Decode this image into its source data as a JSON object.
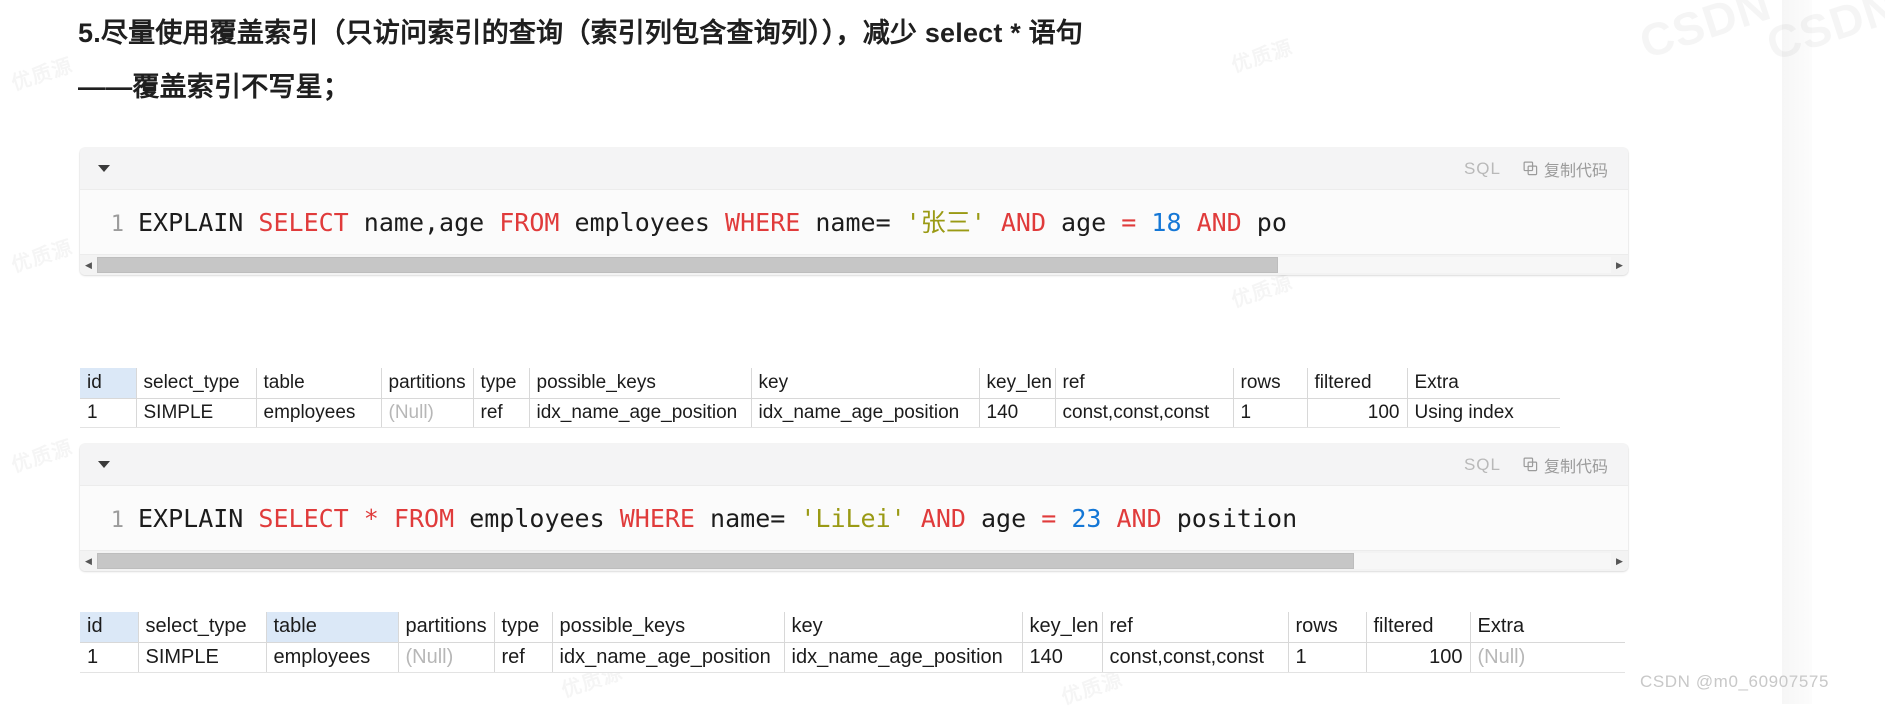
{
  "page": {
    "heading_line1": "5.尽量使用覆盖索引（只访问索引的查询（索引列包含查询列）），减少 select * 语句",
    "heading_line2": "——覆盖索引不写星；",
    "watermark": "CSDN @m0_60907575",
    "bg_watermarks": [
      "CSDN",
      "优质源",
      "优质源",
      "优质源",
      "优质源",
      "优质源"
    ]
  },
  "code_blocks": [
    {
      "lang_label": "SQL",
      "copy_label": "复制代码",
      "collapse_icon": "caret-down-icon",
      "copy_icon": "copy-icon",
      "line_number": "1",
      "tokens": [
        {
          "t": "EXPLAIN ",
          "c": "plain"
        },
        {
          "t": "SELECT",
          "c": "kw"
        },
        {
          "t": " name,age ",
          "c": "plain"
        },
        {
          "t": "FROM",
          "c": "kw"
        },
        {
          "t": " employees ",
          "c": "plain"
        },
        {
          "t": "WHERE",
          "c": "kw"
        },
        {
          "t": " name=",
          "c": "plain"
        },
        {
          "t": " '张三'",
          "c": "str"
        },
        {
          "t": " ",
          "c": "plain"
        },
        {
          "t": "AND",
          "c": "kw"
        },
        {
          "t": " age ",
          "c": "plain"
        },
        {
          "t": "=",
          "c": "op"
        },
        {
          "t": " ",
          "c": "plain"
        },
        {
          "t": "18",
          "c": "num"
        },
        {
          "t": " ",
          "c": "plain"
        },
        {
          "t": "AND",
          "c": "kw"
        },
        {
          "t": " po",
          "c": "plain"
        }
      ],
      "scrollbar": {
        "thumb_percent": 78,
        "left_arrow": "◀",
        "right_arrow": "▶"
      }
    },
    {
      "lang_label": "SQL",
      "copy_label": "复制代码",
      "collapse_icon": "caret-down-icon",
      "copy_icon": "copy-icon",
      "line_number": "1",
      "tokens": [
        {
          "t": "EXPLAIN ",
          "c": "plain"
        },
        {
          "t": "SELECT",
          "c": "kw"
        },
        {
          "t": " ",
          "c": "plain"
        },
        {
          "t": "*",
          "c": "op"
        },
        {
          "t": " ",
          "c": "plain"
        },
        {
          "t": "FROM",
          "c": "kw"
        },
        {
          "t": " employees ",
          "c": "plain"
        },
        {
          "t": "WHERE",
          "c": "kw"
        },
        {
          "t": " name=",
          "c": "plain"
        },
        {
          "t": " 'LiLei'",
          "c": "str"
        },
        {
          "t": " ",
          "c": "plain"
        },
        {
          "t": "AND",
          "c": "kw"
        },
        {
          "t": " age ",
          "c": "plain"
        },
        {
          "t": "=",
          "c": "op"
        },
        {
          "t": " ",
          "c": "plain"
        },
        {
          "t": "23",
          "c": "num"
        },
        {
          "t": " ",
          "c": "plain"
        },
        {
          "t": "AND",
          "c": "kw"
        },
        {
          "t": " position",
          "c": "plain"
        }
      ],
      "scrollbar": {
        "thumb_percent": 83,
        "left_arrow": "◀",
        "right_arrow": "▶"
      }
    }
  ],
  "result_tables": [
    {
      "headers": [
        "id",
        "select_type",
        "table",
        "partitions",
        "type",
        "possible_keys",
        "key",
        "key_len",
        "ref",
        "rows",
        "filtered",
        "Extra"
      ],
      "highlighted_headers": [
        "id"
      ],
      "rows": [
        {
          "id": "1",
          "select_type": "SIMPLE",
          "table": "employees",
          "partitions": "(Null)",
          "type": "ref",
          "possible_keys": "idx_name_age_position",
          "key": "idx_name_age_position",
          "key_len": "140",
          "ref": "const,const,const",
          "rows": "1",
          "filtered": "100",
          "extra": "Using index"
        }
      ]
    },
    {
      "headers": [
        "id",
        "select_type",
        "table",
        "partitions",
        "type",
        "possible_keys",
        "key",
        "key_len",
        "ref",
        "rows",
        "filtered",
        "Extra"
      ],
      "highlighted_headers": [
        "id",
        "table"
      ],
      "rows": [
        {
          "id": "1",
          "select_type": "SIMPLE",
          "table": "employees",
          "partitions": "(Null)",
          "type": "ref",
          "possible_keys": "idx_name_age_position",
          "key": "idx_name_age_position",
          "key_len": "140",
          "ref": "const,const,const",
          "rows": "1",
          "filtered": "100",
          "extra": "(Null)"
        }
      ]
    }
  ],
  "colors": {
    "keyword": "#e03b3b",
    "string": "#9a9a14",
    "number": "#1477d6",
    "header_highlight": "#dbe8f7",
    "null_text": "#b7b7b7"
  }
}
